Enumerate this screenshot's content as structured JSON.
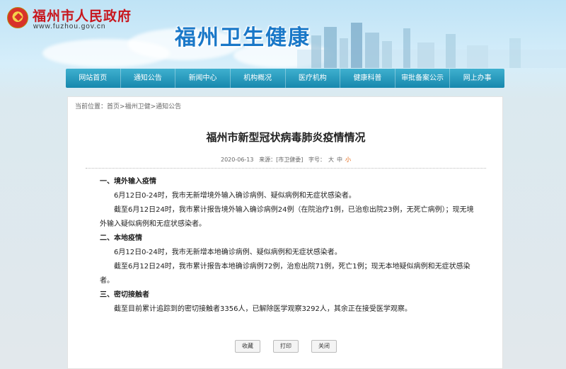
{
  "header": {
    "gov_name": "福州市人民政府",
    "gov_url": "www.fuzhou.gov.cn",
    "site_title": "福州卫生健康"
  },
  "nav": [
    "网站首页",
    "通知公告",
    "新闻中心",
    "机构概况",
    "医疗机构",
    "健康科普",
    "审批备案公示",
    "网上办事"
  ],
  "breadcrumb": {
    "prefix": "当前位置：",
    "items": [
      "首页",
      "福州卫健",
      "通知公告"
    ],
    "sep": ">"
  },
  "article": {
    "title": "福州市新型冠状病毒肺炎疫情情况",
    "date": "2020-06-13",
    "source_label": "来源：",
    "source": "[市卫健委]",
    "size_label": "字号：",
    "size_large": "大",
    "size_medium": "中",
    "size_small": "小",
    "sections": [
      {
        "heading": "一、境外输入疫情",
        "paragraphs": [
          "6月12日0-24时，我市无新增境外输入确诊病例、疑似病例和无症状感染者。",
          "截至6月12日24时，我市累计报告境外输入确诊病例24例（在院治疗1例，已治愈出院23例，无死亡病例）；现无境外输入疑似病例和无症状感染者。"
        ]
      },
      {
        "heading": "二、本地疫情",
        "paragraphs": [
          "6月12日0-24时，我市无新增本地确诊病例、疑似病例和无症状感染者。",
          "截至6月12日24时，我市累计报告本地确诊病例72例，治愈出院71例，死亡1例；现无本地疑似病例和无症状感染者。"
        ]
      },
      {
        "heading": "三、密切接触者",
        "paragraphs": [
          "截至目前累计追踪到的密切接触者3356人，已解除医学观察3292人，其余正在接受医学观察。"
        ]
      }
    ]
  },
  "buttons": {
    "favorite": "收藏",
    "print": "打印",
    "close": "关闭"
  }
}
